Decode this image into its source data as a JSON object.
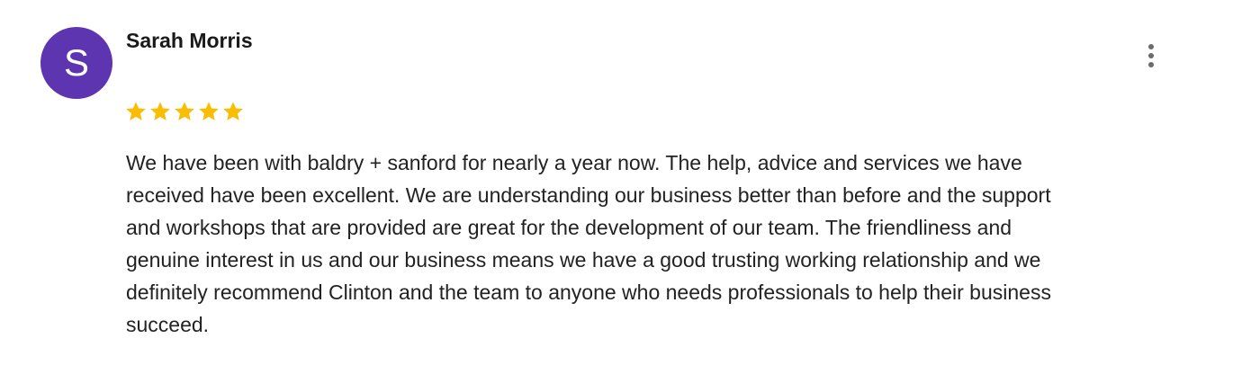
{
  "review": {
    "avatar_letter": "S",
    "author_name": "Sarah Morris",
    "rating": 5,
    "rating_max": 5,
    "text_lines": [
      "We have been with baldry + sanford for nearly a year now. The help, advice and services we have",
      "received have been excellent.  We are understanding our business better than before and the support",
      "and workshops that are provided are great for the development of our team. The friendliness and",
      "genuine interest in us and our business means we have a good trusting working relationship and we",
      "definitely recommend Clinton and the team to anyone who needs professionals to help their business",
      "succeed."
    ],
    "more_icon": "more-vert-icon",
    "star_icon": "star-icon"
  },
  "colors": {
    "avatar_bg": "#5e35b1",
    "star": "#fbbc04",
    "more_dots": "#6b6b6b"
  }
}
